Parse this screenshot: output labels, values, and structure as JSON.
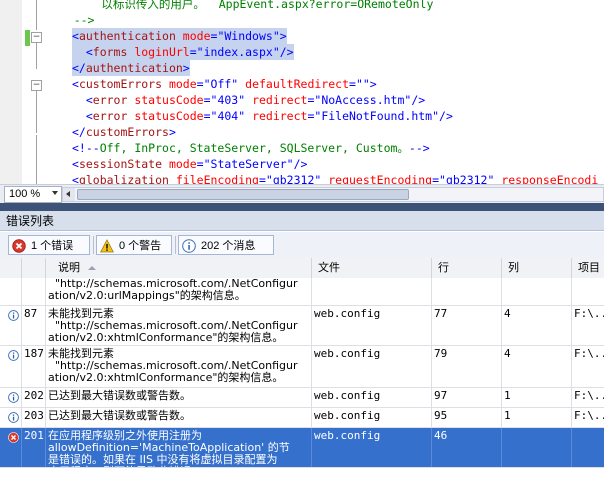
{
  "editor": {
    "lines": [
      {
        "id": "l1",
        "selected": false,
        "parts": [
          [
            "c",
            "        以标识传入的用户。  AppEvent.aspx?error=ORemoteOnly"
          ]
        ]
      },
      {
        "id": "l2",
        "selected": false,
        "parts": [
          [
            "c",
            "    -->"
          ]
        ]
      },
      {
        "id": "l3",
        "selected": true,
        "parts": [
          [
            "p",
            "<"
          ],
          [
            "e",
            "authentication"
          ],
          [
            "a",
            " mode"
          ],
          [
            "p",
            "="
          ],
          [
            "v",
            "\"Windows\""
          ],
          [
            "p",
            ">"
          ]
        ]
      },
      {
        "id": "l4",
        "selected": true,
        "parts": [
          [
            "p",
            "  <"
          ],
          [
            "e",
            "forms"
          ],
          [
            "a",
            " loginUrl"
          ],
          [
            "p",
            "="
          ],
          [
            "v",
            "\"index.aspx\""
          ],
          [
            "p",
            "/>"
          ]
        ]
      },
      {
        "id": "l5",
        "selected": true,
        "parts": [
          [
            "p",
            "</"
          ],
          [
            "e",
            "authentication"
          ],
          [
            "p",
            ">"
          ]
        ]
      },
      {
        "id": "l6",
        "selected": false,
        "parts": [
          [
            "p",
            "<"
          ],
          [
            "e",
            "customErrors"
          ],
          [
            "a",
            " mode"
          ],
          [
            "p",
            "="
          ],
          [
            "v",
            "\"Off\""
          ],
          [
            "a",
            " defaultRedirect"
          ],
          [
            "p",
            "="
          ],
          [
            "v",
            "\"\""
          ],
          [
            "p",
            ">"
          ]
        ]
      },
      {
        "id": "l7",
        "selected": false,
        "parts": [
          [
            "p",
            "  <"
          ],
          [
            "e",
            "error"
          ],
          [
            "a",
            " statusCode"
          ],
          [
            "p",
            "="
          ],
          [
            "v",
            "\"403\""
          ],
          [
            "a",
            " redirect"
          ],
          [
            "p",
            "="
          ],
          [
            "v",
            "\"NoAccess.htm\""
          ],
          [
            "p",
            "/>"
          ]
        ]
      },
      {
        "id": "l8",
        "selected": false,
        "parts": [
          [
            "p",
            "  <"
          ],
          [
            "e",
            "error"
          ],
          [
            "a",
            " statusCode"
          ],
          [
            "p",
            "="
          ],
          [
            "v",
            "\"404\""
          ],
          [
            "a",
            " redirect"
          ],
          [
            "p",
            "="
          ],
          [
            "v",
            "\"FileNotFound.htm\""
          ],
          [
            "p",
            "/>"
          ]
        ]
      },
      {
        "id": "l9",
        "selected": false,
        "parts": [
          [
            "p",
            "</"
          ],
          [
            "e",
            "customErrors"
          ],
          [
            "p",
            ">"
          ]
        ]
      },
      {
        "id": "l10",
        "selected": false,
        "parts": [
          [
            "p",
            "<!--"
          ],
          [
            "c",
            "Off, InProc, StateServer, SQLServer, Custom。"
          ],
          [
            "p",
            "-->"
          ]
        ]
      },
      {
        "id": "l11",
        "selected": false,
        "parts": [
          [
            "p",
            "<"
          ],
          [
            "e",
            "sessionState"
          ],
          [
            "a",
            " mode"
          ],
          [
            "p",
            "="
          ],
          [
            "v",
            "\"StateServer\""
          ],
          [
            "p",
            "/>"
          ]
        ]
      },
      {
        "id": "l12",
        "selected": false,
        "parts": [
          [
            "p",
            "<"
          ],
          [
            "e",
            "globalization"
          ],
          [
            "a",
            " fileEncoding"
          ],
          [
            "p",
            "="
          ],
          [
            "v",
            "\"gb2312\""
          ],
          [
            "a",
            " requestEncoding"
          ],
          [
            "p",
            "="
          ],
          [
            "v",
            "\"gb2312\""
          ],
          [
            "a",
            " responseEncodi"
          ]
        ]
      }
    ]
  },
  "zoom": {
    "value": "100 %"
  },
  "error_list": {
    "title": "错误列表",
    "filters": {
      "errors": "1 个错误",
      "warnings": "0 个警告",
      "messages": "202 个消息"
    },
    "columns": {
      "description": "说明",
      "file": "文件",
      "line": "行",
      "column": "列",
      "project": "项目"
    },
    "rows": [
      {
        "kind": "info",
        "num": "",
        "desc": "  \"http://schemas.microsoft.com/.NetConfigur\nation/v2.0:urlMappings\"的架构信息。",
        "file": "",
        "line": "",
        "col": "",
        "proj": ""
      },
      {
        "kind": "info",
        "num": "87",
        "desc": "未能找到元素\n  \"http://schemas.microsoft.com/.NetConfigur\nation/v2.0:xhtmlConformance\"的架构信息。",
        "file": "web.config",
        "line": "77",
        "col": "4",
        "proj": "F:\\..."
      },
      {
        "kind": "info",
        "num": "187",
        "desc": "未能找到元素\n  \"http://schemas.microsoft.com/.NetConfigur\nation/v2.0:xhtmlConformance\"的架构信息。",
        "file": "web.config",
        "line": "79",
        "col": "4",
        "proj": "F:\\..."
      },
      {
        "kind": "info",
        "num": "202",
        "desc": "已达到最大错误数或警告数。",
        "file": "web.config",
        "line": "97",
        "col": "1",
        "proj": "F:\\..."
      },
      {
        "kind": "info",
        "num": "203",
        "desc": "已达到最大错误数或警告数。",
        "file": "web.config",
        "line": "95",
        "col": "1",
        "proj": "F:\\..."
      },
      {
        "kind": "error",
        "num": "201",
        "desc": "在应用程序级别之外使用注册为\nallowDefinition='MachineToApplication' 的节\n是错误的。如果在 IIS 中没有将虚拟目录配置为\n应用程序，则可能导致此错误。",
        "file": "web.config",
        "line": "46",
        "col": "",
        "proj": ""
      }
    ]
  },
  "colors": {
    "selection": "#3470cc",
    "editor_selection": "#c5d3ee",
    "splitter": "#3d5277"
  }
}
